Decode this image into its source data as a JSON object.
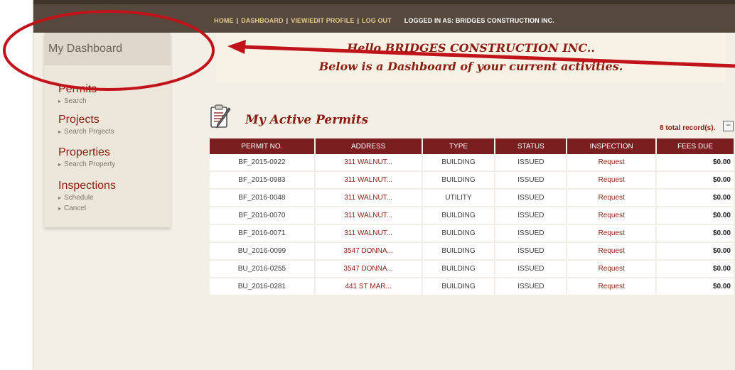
{
  "nav": {
    "home": "HOME",
    "dashboard": "DASHBOARD",
    "profile": "VIEW/EDIT PROFILE",
    "logout": "LOG OUT",
    "logged_in": "LOGGED IN AS:  BRIDGES CONSTRUCTION INC.",
    "separator": "|"
  },
  "sidebar": {
    "heading": "My Dashboard",
    "groups": [
      {
        "title": "Permits",
        "links": [
          "Search"
        ]
      },
      {
        "title": "Projects",
        "links": [
          "Search Projects"
        ]
      },
      {
        "title": "Properties",
        "links": [
          "Search Property"
        ]
      },
      {
        "title": "Inspections",
        "links": [
          "Schedule",
          "Cancel"
        ]
      }
    ]
  },
  "greeting": {
    "line1": "Hello BRIDGES CONSTRUCTION INC..",
    "line2": "Below is a Dashboard of your current activities."
  },
  "permits": {
    "title": "My Active Permits",
    "total": "8 total record(s).",
    "collapse_symbol": "−",
    "columns": [
      "PERMIT NO.",
      "ADDRESS",
      "TYPE",
      "STATUS",
      "INSPECTION",
      "FEES DUE"
    ],
    "rows": [
      [
        "BF_2015-0922",
        "311 WALNUT...",
        "BUILDING",
        "ISSUED",
        "Request",
        "$0.00"
      ],
      [
        "BF_2015-0983",
        "311 WALNUT...",
        "BUILDING",
        "ISSUED",
        "Request",
        "$0.00"
      ],
      [
        "BF_2016-0048",
        "311 WALNUT...",
        "UTILITY",
        "ISSUED",
        "Request",
        "$0.00"
      ],
      [
        "BF_2016-0070",
        "311 WALNUT...",
        "BUILDING",
        "ISSUED",
        "Request",
        "$0.00"
      ],
      [
        "BF_2016-0071",
        "311 WALNUT...",
        "BUILDING",
        "ISSUED",
        "Request",
        "$0.00"
      ],
      [
        "BU_2016-0099",
        "3547 DONNA...",
        "BUILDING",
        "ISSUED",
        "Request",
        "$0.00"
      ],
      [
        "BU_2016-0255",
        "3547 DONNA...",
        "BUILDING",
        "ISSUED",
        "Request",
        "$0.00"
      ],
      [
        "BU_2016-0281",
        "441 ST MAR...",
        "BUILDING",
        "ISSUED",
        "Request",
        "$0.00"
      ]
    ]
  },
  "colors": {
    "accent": "#8a1d12",
    "header_bar": "#55493d",
    "table_header": "#7b1e20",
    "annotation": "#c0141a"
  },
  "icons": {
    "permits": "clipboard-icon",
    "annotation": "red-circle-and-arrow"
  }
}
